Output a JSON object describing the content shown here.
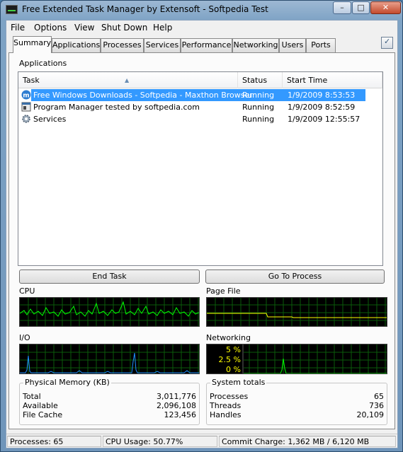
{
  "window": {
    "title": "Free Extended Task Manager by Extensoft - Softpedia Test"
  },
  "menu": [
    "File",
    "Options",
    "View",
    "Shut Down",
    "Help"
  ],
  "tabs": [
    "Summary",
    "Applications",
    "Processes",
    "Services",
    "Performance",
    "Networking",
    "Users",
    "Ports"
  ],
  "applications": {
    "label": "Applications",
    "columns": [
      "Task",
      "Status",
      "Start Time"
    ],
    "rows": [
      {
        "task": "Free Windows Downloads - Softpedia - Maxthon Browser",
        "status": "Running",
        "start": "1/9/2009 8:53:53",
        "icon": "maxthon-icon",
        "selected": true
      },
      {
        "task": "Program Manager tested by softpedia.com",
        "status": "Running",
        "start": "1/9/2009 8:52:59",
        "icon": "program-manager-icon",
        "selected": false
      },
      {
        "task": "Services",
        "status": "Running",
        "start": "1/9/2009 12:55:57",
        "icon": "gear-icon",
        "selected": false
      }
    ]
  },
  "buttons": {
    "end_task": "End Task",
    "go_to_process": "Go To Process"
  },
  "graphs": {
    "cpu": {
      "label": "CPU",
      "color": "#00ff00"
    },
    "page_file": {
      "label": "Page File",
      "color": "#ffff00"
    },
    "io": {
      "label": "I/O",
      "color": "#1e90ff"
    },
    "networking": {
      "label": "Networking",
      "color": "#00ff00",
      "scale": [
        "5 %",
        "2.5 %",
        "0 %"
      ]
    }
  },
  "physical_memory": {
    "title": "Physical Memory (KB)",
    "items": [
      {
        "label": "Total",
        "value": "3,011,776"
      },
      {
        "label": "Available",
        "value": "2,096,108"
      },
      {
        "label": "File Cache",
        "value": "123,456"
      }
    ]
  },
  "system_totals": {
    "title": "System totals",
    "items": [
      {
        "label": "Processes",
        "value": "65"
      },
      {
        "label": "Threads",
        "value": "736"
      },
      {
        "label": "Handles",
        "value": "20,109"
      }
    ]
  },
  "status": {
    "processes": "Processes: 65",
    "cpu_usage": "CPU Usage: 50.77%",
    "commit_charge": "Commit Charge: 1,362 MB / 6,120 MB"
  }
}
